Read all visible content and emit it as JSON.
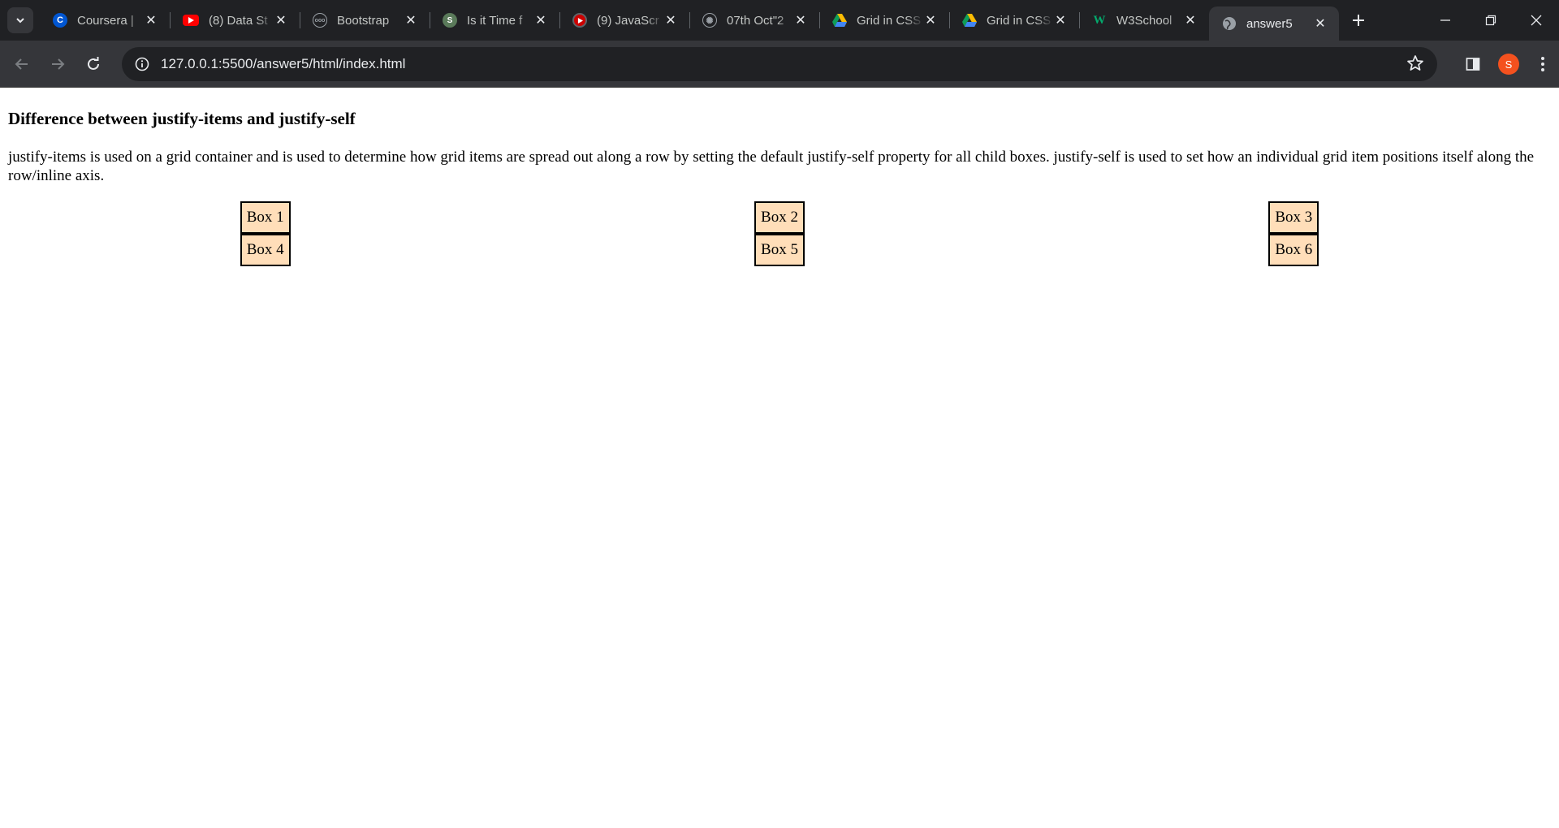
{
  "browser": {
    "tabs": [
      {
        "title": "Coursera |",
        "icon": "coursera-icon"
      },
      {
        "title": "(8) Data St",
        "icon": "youtube-icon"
      },
      {
        "title": "Bootstrap",
        "icon": "bootstrap-icon"
      },
      {
        "title": "Is it Time f",
        "icon": "globe-icon"
      },
      {
        "title": "(9) JavaScr",
        "icon": "youtube-icon"
      },
      {
        "title": "07th Oct\"2",
        "icon": "openai-icon"
      },
      {
        "title": "Grid in CSS",
        "icon": "google-drive-icon"
      },
      {
        "title": "Grid in CSS",
        "icon": "google-drive-icon"
      },
      {
        "title": "W3School",
        "icon": "w3schools-icon"
      },
      {
        "title": "answer5",
        "icon": "globe-icon",
        "active": true
      }
    ],
    "url": "127.0.0.1:5500/answer5/html/index.html",
    "profile_initial": "S"
  },
  "page": {
    "heading": "Difference between justify-items and justify-self",
    "paragraph": "justify-items is used on a grid container and is used to determine how grid items are spread out along a row by setting the default justify-self property for all child boxes. justify-self is used to set how an individual grid item positions itself along the row/inline axis.",
    "boxes": [
      "Box 1",
      "Box 2",
      "Box 3",
      "Box 4",
      "Box 5",
      "Box 6"
    ]
  },
  "colors": {
    "box_bg": "#ffdeb9",
    "tabstrip_bg": "#202124",
    "toolbar_bg": "#35363a",
    "avatar_bg": "#f4511e"
  }
}
